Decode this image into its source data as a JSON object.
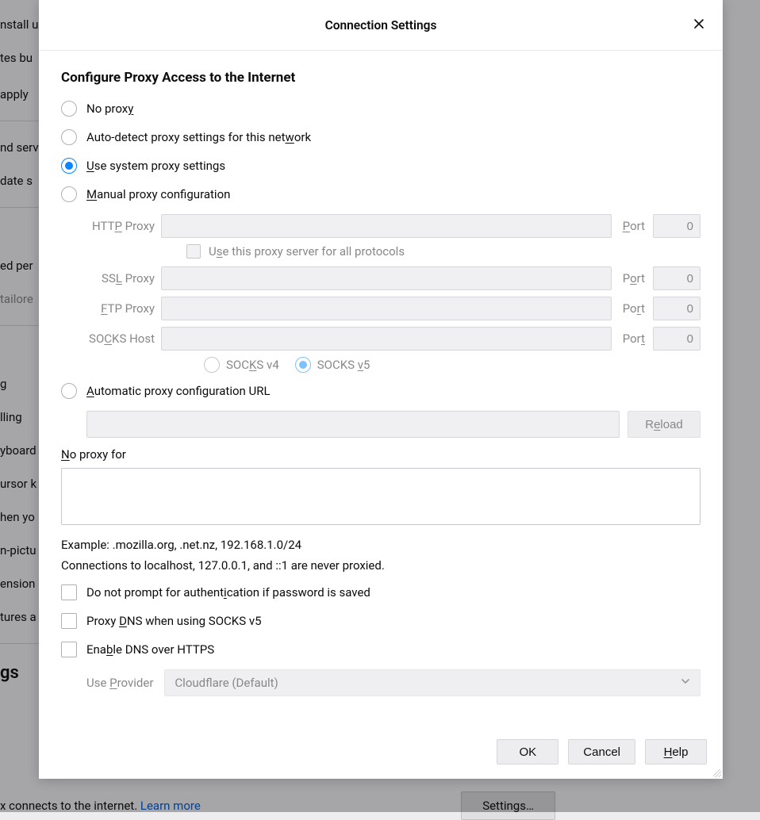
{
  "background": {
    "left_items_top": [
      "nstall u",
      "tes bu",
      "apply"
    ],
    "left_items_mid": [
      "nd serv",
      "date s"
    ],
    "left_items_b1": [
      "ed per",
      "tailore"
    ],
    "left_items_b2": [
      "g",
      "lling",
      "yboard",
      "ursor k",
      "hen yo",
      "n-pictu",
      "ension",
      "tures a"
    ],
    "heading": "gs",
    "bottom_text_pre": "x connects to the internet. ",
    "bottom_link": "Learn more",
    "settings_btn": "Settings…"
  },
  "dialog": {
    "title": "Connection Settings",
    "section_heading": "Configure Proxy Access to the Internet",
    "radios": {
      "no_proxy_pre": "No prox",
      "no_proxy_u": "y",
      "auto_detect_pre": "Auto-detect proxy settings for this net",
      "auto_detect_u": "w",
      "auto_detect_post": "ork",
      "use_system_u": "U",
      "use_system_post": "se system proxy settings",
      "manual_u": "M",
      "manual_post": "anual proxy configuration",
      "auto_url_u": "A",
      "auto_url_post": "utomatic proxy configuration URL"
    },
    "proxy": {
      "http_label_pre": "HTT",
      "http_label_u": "P",
      "http_label_post": " Proxy",
      "http_port_u": "P",
      "http_port_post": "ort",
      "all_proto_pre": "U",
      "all_proto_u": "s",
      "all_proto_post": "e this proxy server for all protocols",
      "ssl_label_pre": "SS",
      "ssl_label_u": "L",
      "ssl_label_post": " Proxy",
      "ssl_port_pre": "P",
      "ssl_port_u": "o",
      "ssl_port_post": "rt",
      "ftp_label_u": "F",
      "ftp_label_post": "TP Proxy",
      "ftp_port_pre": "Po",
      "ftp_port_u": "r",
      "ftp_port_post": "t",
      "socks_label_pre": "SO",
      "socks_label_u": "C",
      "socks_label_post": "KS Host",
      "socks_port_pre": "Por",
      "socks_port_u": "t",
      "http_value": "",
      "http_port": "0",
      "ssl_value": "",
      "ssl_port": "0",
      "ftp_value": "",
      "ftp_port": "0",
      "socks_value": "",
      "socks_port": "0",
      "socks_v4_pre": "SOC",
      "socks_v4_u": "K",
      "socks_v4_post": "S v4",
      "socks_v5_pre": "SOCKS ",
      "socks_v5_u": "v",
      "socks_v5_post": "5"
    },
    "auto_url_value": "",
    "reload_pre": "R",
    "reload_u": "e",
    "reload_post": "load",
    "no_proxy_for_u": "N",
    "no_proxy_for_post": "o proxy for",
    "no_proxy_value": "",
    "example": "Example: .mozilla.org, .net.nz, 192.168.1.0/24",
    "localhost_note": "Connections to localhost, 127.0.0.1, and ::1 are never proxied.",
    "checks": {
      "no_prompt_pre": "Do not prompt for authent",
      "no_prompt_u": "i",
      "no_prompt_post": "cation if password is saved",
      "proxy_dns_pre": "Proxy ",
      "proxy_dns_u": "D",
      "proxy_dns_post": "NS when using SOCKS v5",
      "enable_doh_pre": "Ena",
      "enable_doh_u": "b",
      "enable_doh_post": "le DNS over HTTPS"
    },
    "provider_label_pre": "Use ",
    "provider_label_u": "P",
    "provider_label_post": "rovider",
    "provider_value": "Cloudflare (Default)",
    "footer": {
      "ok": "OK",
      "cancel": "Cancel",
      "help_u": "H",
      "help_post": "elp"
    }
  }
}
